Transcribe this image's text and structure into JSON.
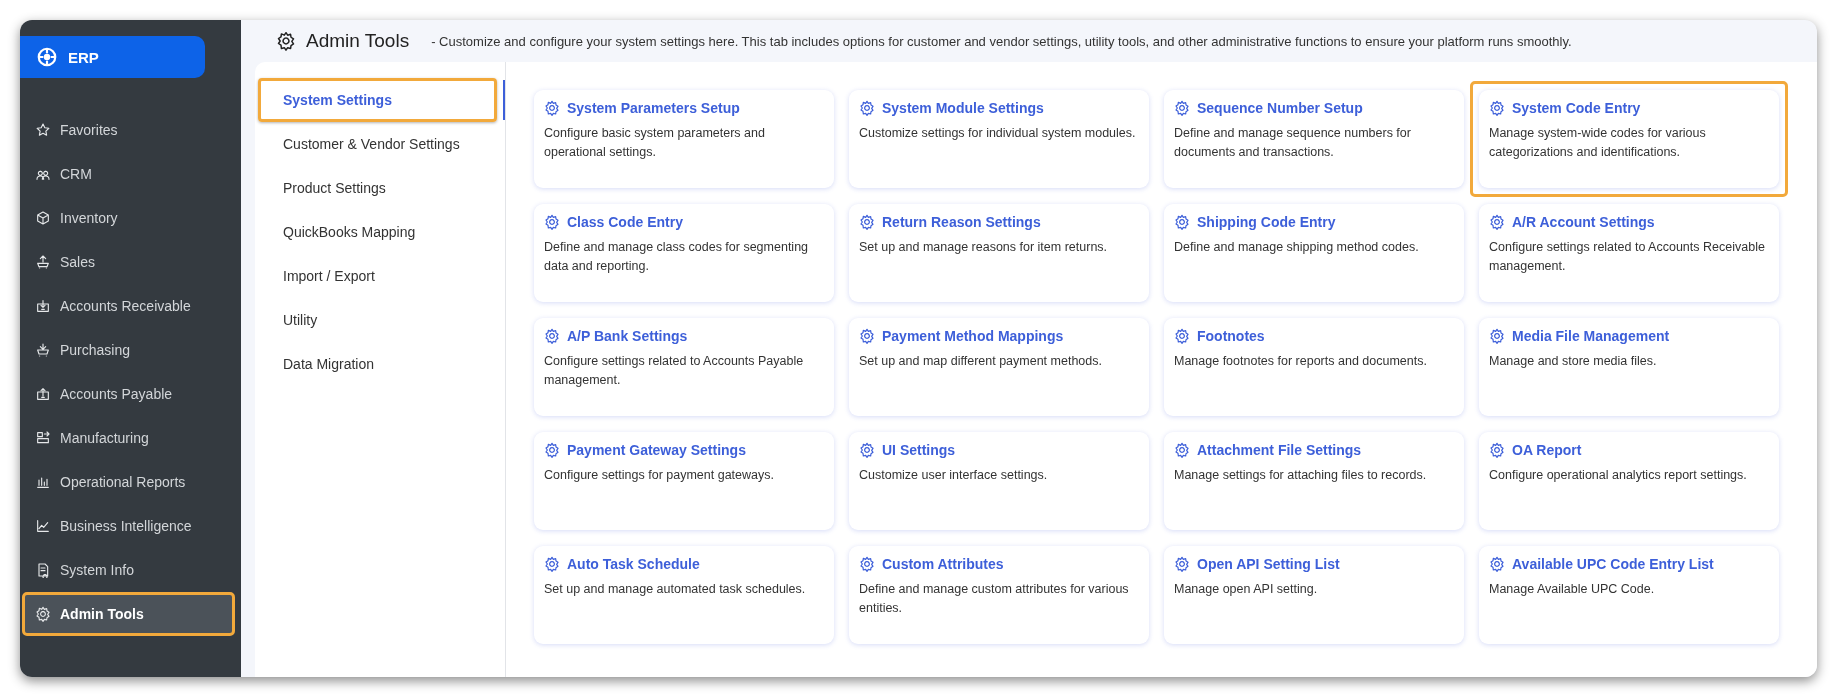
{
  "sidebar": {
    "logo": "ERP",
    "items": [
      {
        "label": "Favorites",
        "selected": false,
        "highlighted": false
      },
      {
        "label": "CRM",
        "selected": false,
        "highlighted": false
      },
      {
        "label": "Inventory",
        "selected": false,
        "highlighted": false
      },
      {
        "label": "Sales",
        "selected": false,
        "highlighted": false
      },
      {
        "label": "Accounts Receivable",
        "selected": false,
        "highlighted": false
      },
      {
        "label": "Purchasing",
        "selected": false,
        "highlighted": false
      },
      {
        "label": "Accounts Payable",
        "selected": false,
        "highlighted": false
      },
      {
        "label": "Manufacturing",
        "selected": false,
        "highlighted": false
      },
      {
        "label": "Operational Reports",
        "selected": false,
        "highlighted": false
      },
      {
        "label": "Business Intelligence",
        "selected": false,
        "highlighted": false
      },
      {
        "label": "System Info",
        "selected": false,
        "highlighted": false
      },
      {
        "label": "Admin Tools",
        "selected": true,
        "highlighted": true
      }
    ]
  },
  "header": {
    "title": "Admin Tools",
    "description": "- Customize and configure your system settings here. This tab includes options for customer and vendor settings, utility tools, and other administrative functions to ensure your platform runs smoothly."
  },
  "tabs": [
    {
      "label": "System Settings",
      "selected": true,
      "highlighted": true
    },
    {
      "label": "Customer & Vendor Settings",
      "selected": false,
      "highlighted": false
    },
    {
      "label": "Product Settings",
      "selected": false,
      "highlighted": false
    },
    {
      "label": "QuickBooks Mapping",
      "selected": false,
      "highlighted": false
    },
    {
      "label": "Import / Export",
      "selected": false,
      "highlighted": false
    },
    {
      "label": "Utility",
      "selected": false,
      "highlighted": false
    },
    {
      "label": "Data Migration",
      "selected": false,
      "highlighted": false
    }
  ],
  "cards": [
    {
      "title": "System Parameters Setup",
      "description": "Configure basic system parameters and operational settings.",
      "highlighted": false
    },
    {
      "title": "System Module Settings",
      "description": "Customize settings for individual system modules.",
      "highlighted": false
    },
    {
      "title": "Sequence Number Setup",
      "description": "Define and manage sequence numbers for documents and transactions.",
      "highlighted": false
    },
    {
      "title": "System Code Entry",
      "description": "Manage system-wide codes for various categorizations and identifications.",
      "highlighted": true
    },
    {
      "title": "Class Code Entry",
      "description": "Define and manage class codes for segmenting data and reporting.",
      "highlighted": false
    },
    {
      "title": "Return Reason Settings",
      "description": "Set up and manage reasons for item returns.",
      "highlighted": false
    },
    {
      "title": "Shipping Code Entry",
      "description": "Define and manage shipping method codes.",
      "highlighted": false
    },
    {
      "title": "A/R Account Settings",
      "description": "Configure settings related to Accounts Receivable management.",
      "highlighted": false
    },
    {
      "title": "A/P Bank Settings",
      "description": "Configure settings related to Accounts Payable management.",
      "highlighted": false
    },
    {
      "title": "Payment Method Mappings",
      "description": "Set up and map different payment methods.",
      "highlighted": false
    },
    {
      "title": "Footnotes",
      "description": "Manage footnotes for reports and documents.",
      "highlighted": false
    },
    {
      "title": "Media File Management",
      "description": "Manage and store media files.",
      "highlighted": false
    },
    {
      "title": "Payment Gateway Settings",
      "description": "Configure settings for payment gateways.",
      "highlighted": false
    },
    {
      "title": "UI Settings",
      "description": "Customize user interface settings.",
      "highlighted": false
    },
    {
      "title": "Attachment File Settings",
      "description": "Manage settings for attaching files to records.",
      "highlighted": false
    },
    {
      "title": "OA Report",
      "description": "Configure operational analytics report settings.",
      "highlighted": false
    },
    {
      "title": "Auto Task Schedule",
      "description": "Set up and manage automated task schedules.",
      "highlighted": false
    },
    {
      "title": "Custom Attributes",
      "description": "Define and manage custom attributes for various entities.",
      "highlighted": false
    },
    {
      "title": "Open API Setting List",
      "description": "Manage open API setting.",
      "highlighted": false
    },
    {
      "title": "Available UPC Code Entry List",
      "description": "Manage Available UPC Code.",
      "highlighted": false
    }
  ]
}
